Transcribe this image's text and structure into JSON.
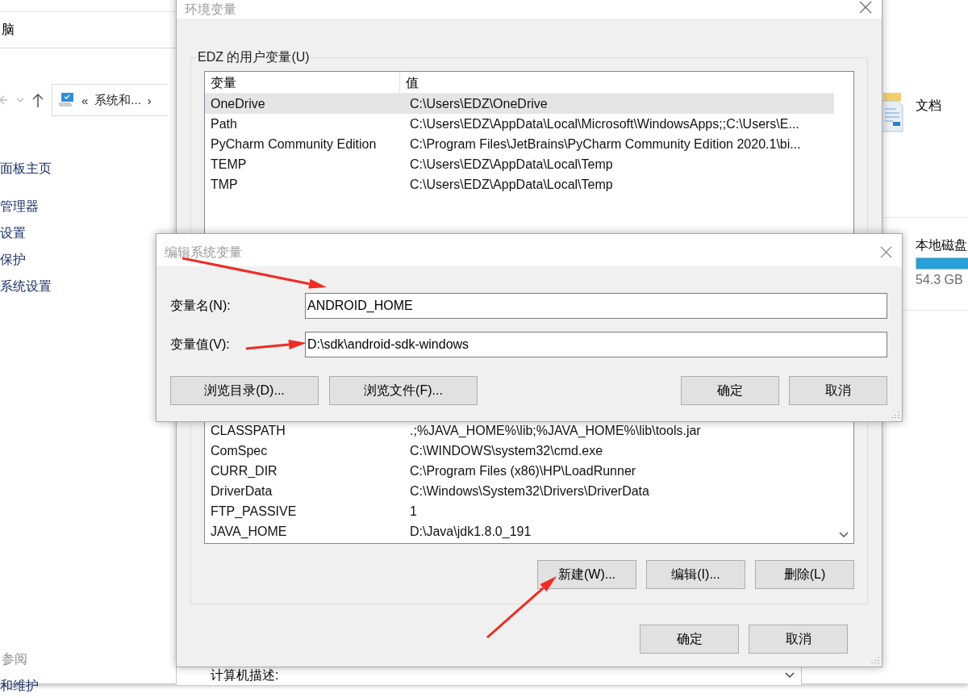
{
  "explorer": {
    "title": "脑",
    "breadcrumb": [
      "«",
      "系统和...",
      "›"
    ],
    "sidebar_links": [
      "面板主页",
      "管理器",
      "设置",
      "保护",
      "系统设置"
    ],
    "see_also_heading": "参阅",
    "see_also_links": [
      "和维护"
    ],
    "folders": [
      {
        "name": "文档"
      }
    ],
    "drives": [
      {
        "name": "本地磁盘",
        "level": 1,
        "free": "54.3 GB"
      }
    ]
  },
  "system_window": {
    "description_label": "计算机描述:"
  },
  "env_window": {
    "title": "环境变量",
    "user_group_label": "EDZ 的用户变量(U)",
    "user_table": {
      "columns": [
        "变量",
        "值"
      ],
      "rows": [
        {
          "name": "OneDrive",
          "value": "C:\\Users\\EDZ\\OneDrive",
          "selected": true
        },
        {
          "name": "Path",
          "value": "C:\\Users\\EDZ\\AppData\\Local\\Microsoft\\WindowsApps;;C:\\Users\\E...",
          "selected": false
        },
        {
          "name": "PyCharm Community Edition",
          "value": "C:\\Program Files\\JetBrains\\PyCharm Community Edition 2020.1\\bi...",
          "selected": false
        },
        {
          "name": "TEMP",
          "value": "C:\\Users\\EDZ\\AppData\\Local\\Temp",
          "selected": false
        },
        {
          "name": "TMP",
          "value": "C:\\Users\\EDZ\\AppData\\Local\\Temp",
          "selected": false
        }
      ]
    },
    "system_table": {
      "rows": [
        {
          "name": "CLASSPATH",
          "value": " .;%JAVA_HOME%\\lib;%JAVA_HOME%\\lib\\tools.jar"
        },
        {
          "name": "ComSpec",
          "value": "C:\\WINDOWS\\system32\\cmd.exe"
        },
        {
          "name": "CURR_DIR",
          "value": "C:\\Program Files (x86)\\HP\\LoadRunner"
        },
        {
          "name": "DriverData",
          "value": "C:\\Windows\\System32\\Drivers\\DriverData"
        },
        {
          "name": "FTP_PASSIVE",
          "value": "1"
        },
        {
          "name": "JAVA_HOME",
          "value": "D:\\Java\\jdk1.8.0_191"
        }
      ]
    },
    "system_buttons": [
      "新建(W)...",
      "编辑(I)...",
      "删除(L)"
    ],
    "buttons": [
      "确定",
      "取消"
    ]
  },
  "edit_dialog": {
    "title": "编辑系统变量",
    "fields": [
      {
        "label": "变量名(N):",
        "value": "ANDROID_HOME"
      },
      {
        "label": "变量值(V):",
        "value": "D:\\sdk\\android-sdk-windows"
      }
    ],
    "left_buttons": [
      "浏览目录(D)...",
      "浏览文件(F)..."
    ],
    "right_buttons": [
      "确定",
      "取消"
    ]
  }
}
